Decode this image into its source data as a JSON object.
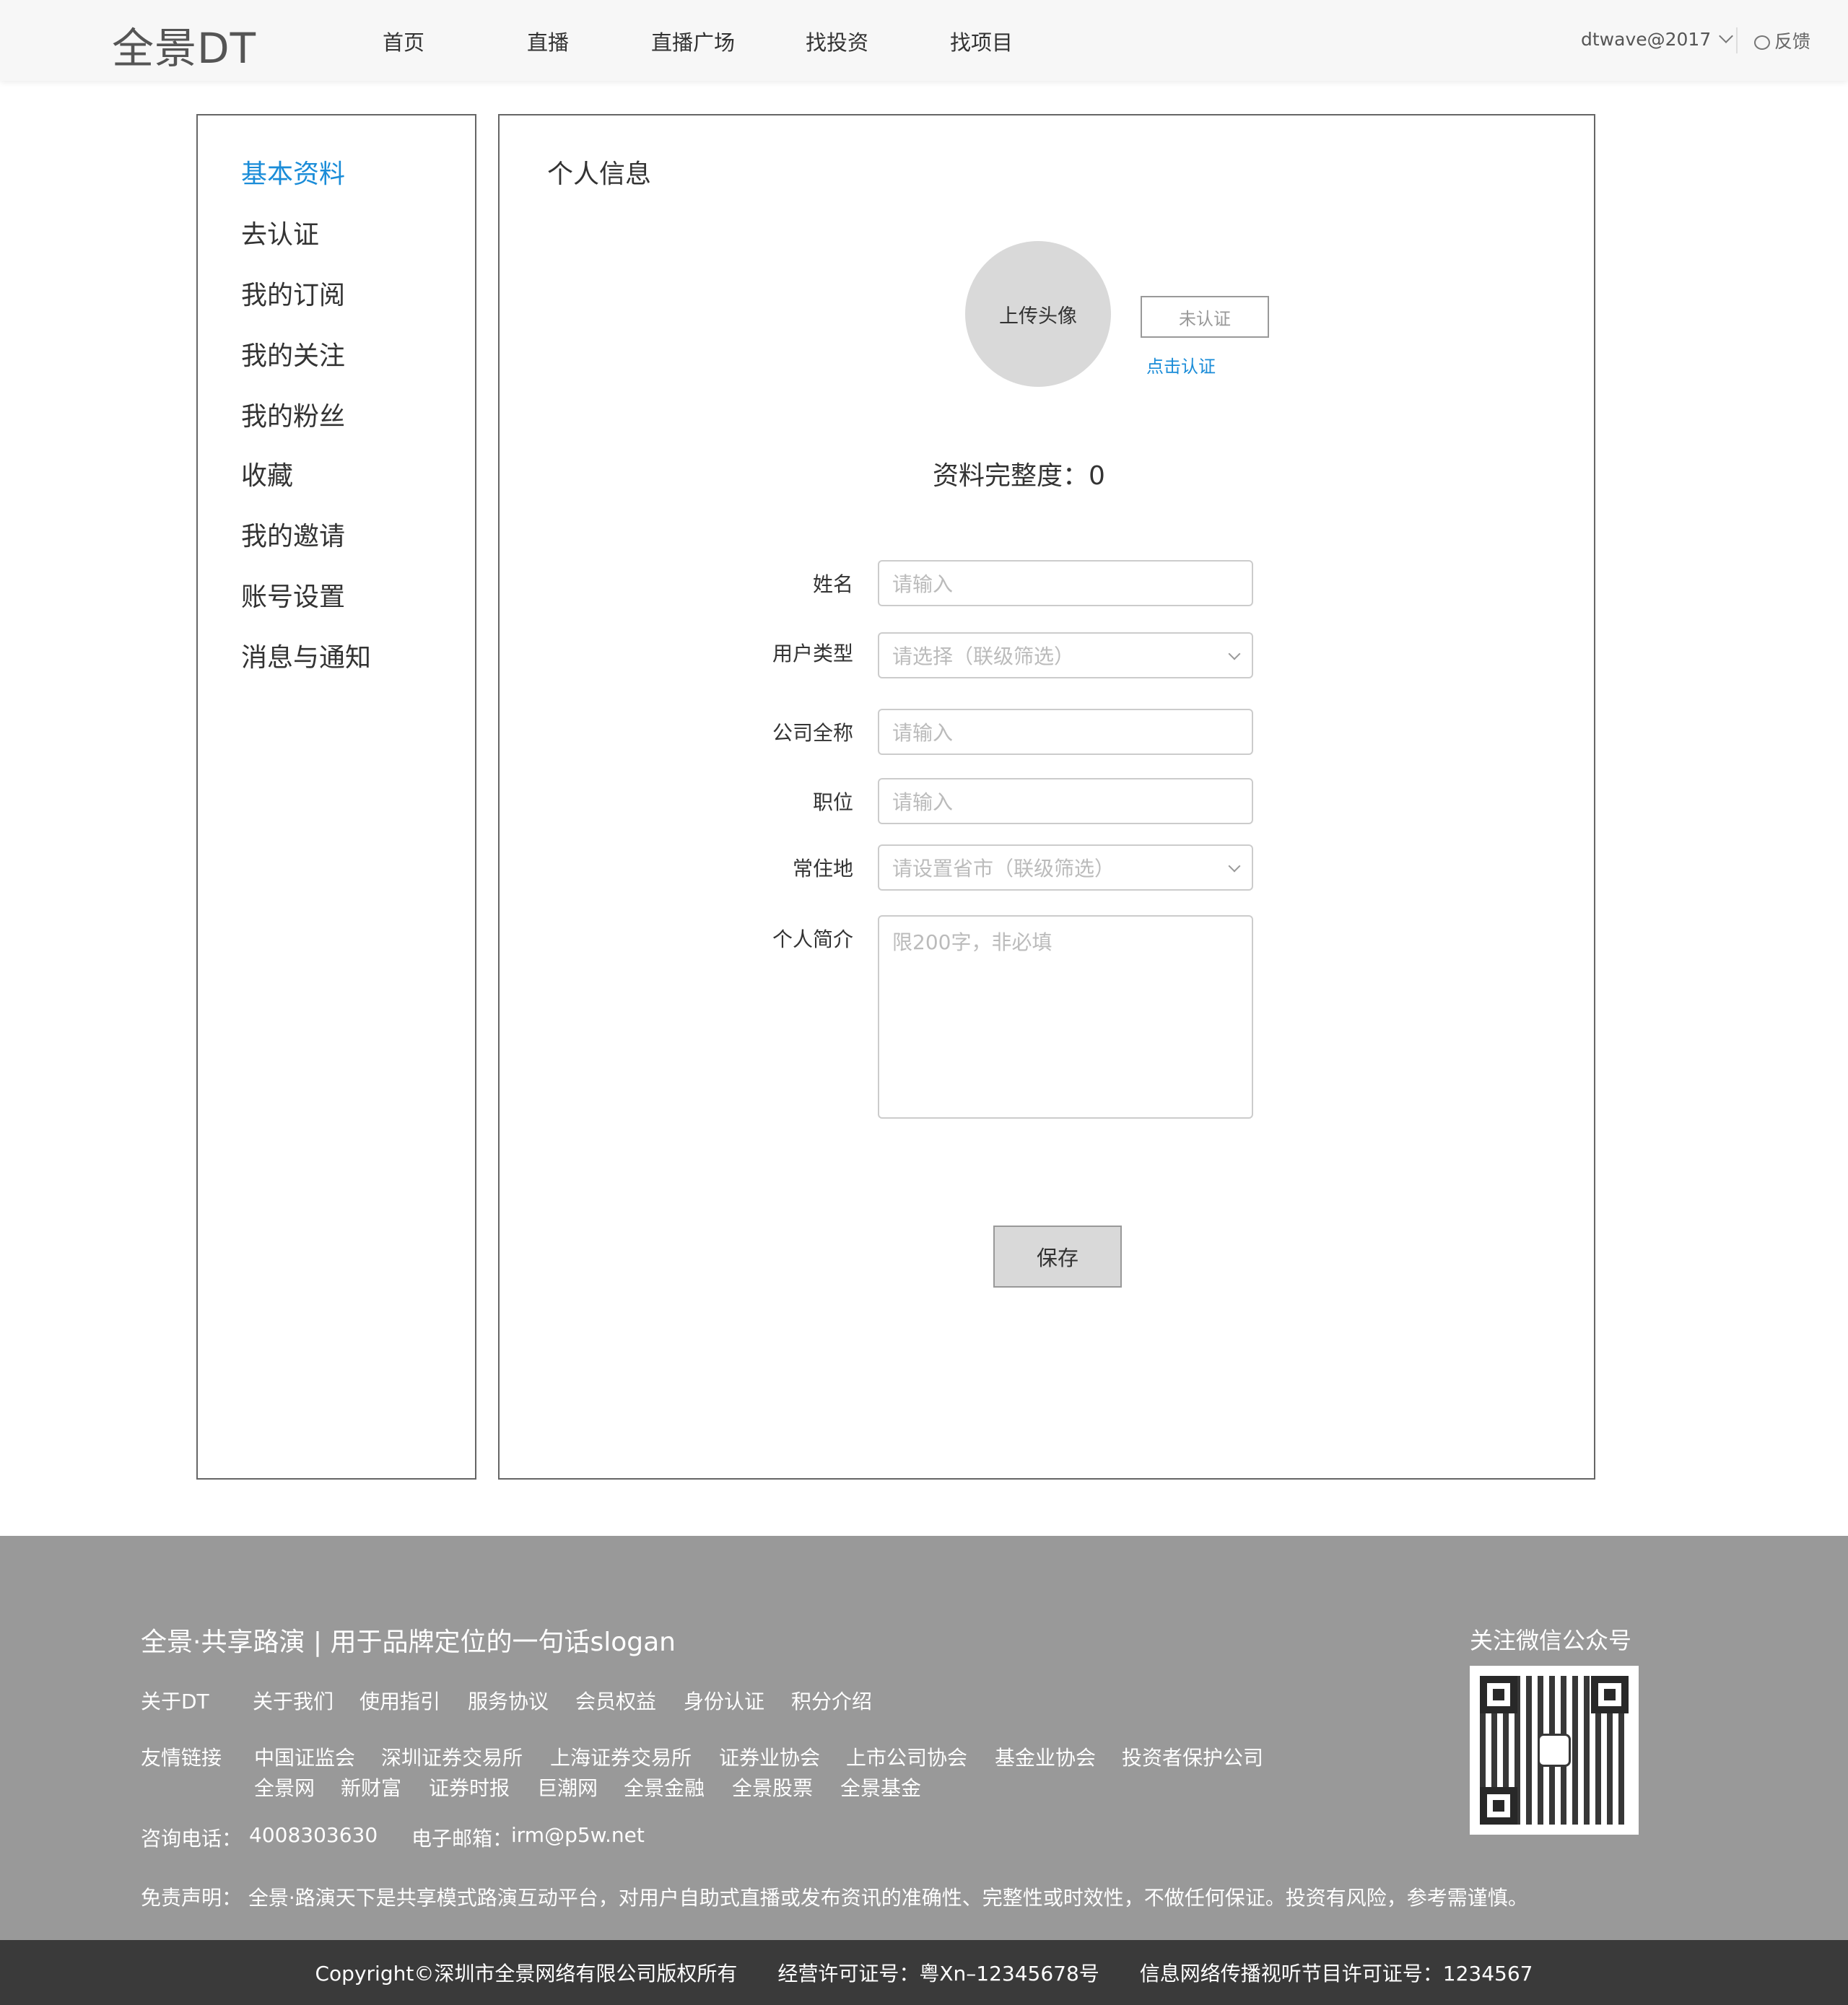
{
  "header": {
    "logo": "全景DT",
    "nav": [
      "首页",
      "直播",
      "直播广场",
      "找投资",
      "找项目"
    ],
    "user": "dtwave@2017",
    "feedback": "反馈"
  },
  "sidebar": {
    "items": [
      {
        "label": "基本资料",
        "active": true
      },
      {
        "label": "去认证"
      },
      {
        "label": "我的订阅"
      },
      {
        "label": "我的关注"
      },
      {
        "label": "我的粉丝"
      },
      {
        "label": "收藏"
      },
      {
        "label": "我的邀请"
      },
      {
        "label": "账号设置"
      },
      {
        "label": "消息与通知"
      }
    ]
  },
  "main": {
    "title": "个人信息",
    "avatar_label": "上传头像",
    "status_badge": "未认证",
    "verify_link": "点击认证",
    "completeness": "资料完整度：0",
    "form": {
      "name": {
        "label": "姓名",
        "placeholder": "请输入"
      },
      "user_type": {
        "label": "用户类型",
        "placeholder": "请选择（联级筛选）"
      },
      "company": {
        "label": "公司全称",
        "placeholder": "请输入"
      },
      "position": {
        "label": "职位",
        "placeholder": "请输入"
      },
      "location": {
        "label": "常住地",
        "placeholder": "请设置省市（联级筛选）"
      },
      "bio": {
        "label": "个人简介",
        "placeholder": "限200字，非必填"
      }
    },
    "save_label": "保存"
  },
  "footer": {
    "slogan": "全景·共享路演 | 用于品牌定位的一句话slogan",
    "about_label": "关于DT",
    "about_links": [
      "关于我们",
      "使用指引",
      "服务协议",
      "会员权益",
      "身份认证",
      "积分介绍"
    ],
    "friends_label": "友情链接",
    "friends_row1": [
      "中国证监会",
      "深圳证券交易所",
      "上海证券交易所",
      "证券业协会",
      "上市公司协会",
      "基金业协会",
      "投资者保护公司"
    ],
    "friends_row2": [
      "全景网",
      "新财富",
      "证券时报",
      "巨潮网",
      "全景金融",
      "全景股票",
      "全景基金"
    ],
    "phone_label": "咨询电话：",
    "phone": "4008303630",
    "email_label": "电子邮箱：",
    "email": "irm@p5w.net",
    "disclaimer": "免责声明：  全景·路演天下是共享模式路演互动平台，对用户自助式直播或发布资讯的准确性、完整性或时效性，不做任何保证。投资有风险，参考需谨慎。",
    "wechat_title": "关注微信公众号",
    "copyright": "Copyright©深圳市全景网络有限公司版权所有",
    "license": "经营许可证号：粤Xn–12345678号",
    "av_license": "信息网络传播视听节目许可证号：1234567"
  }
}
